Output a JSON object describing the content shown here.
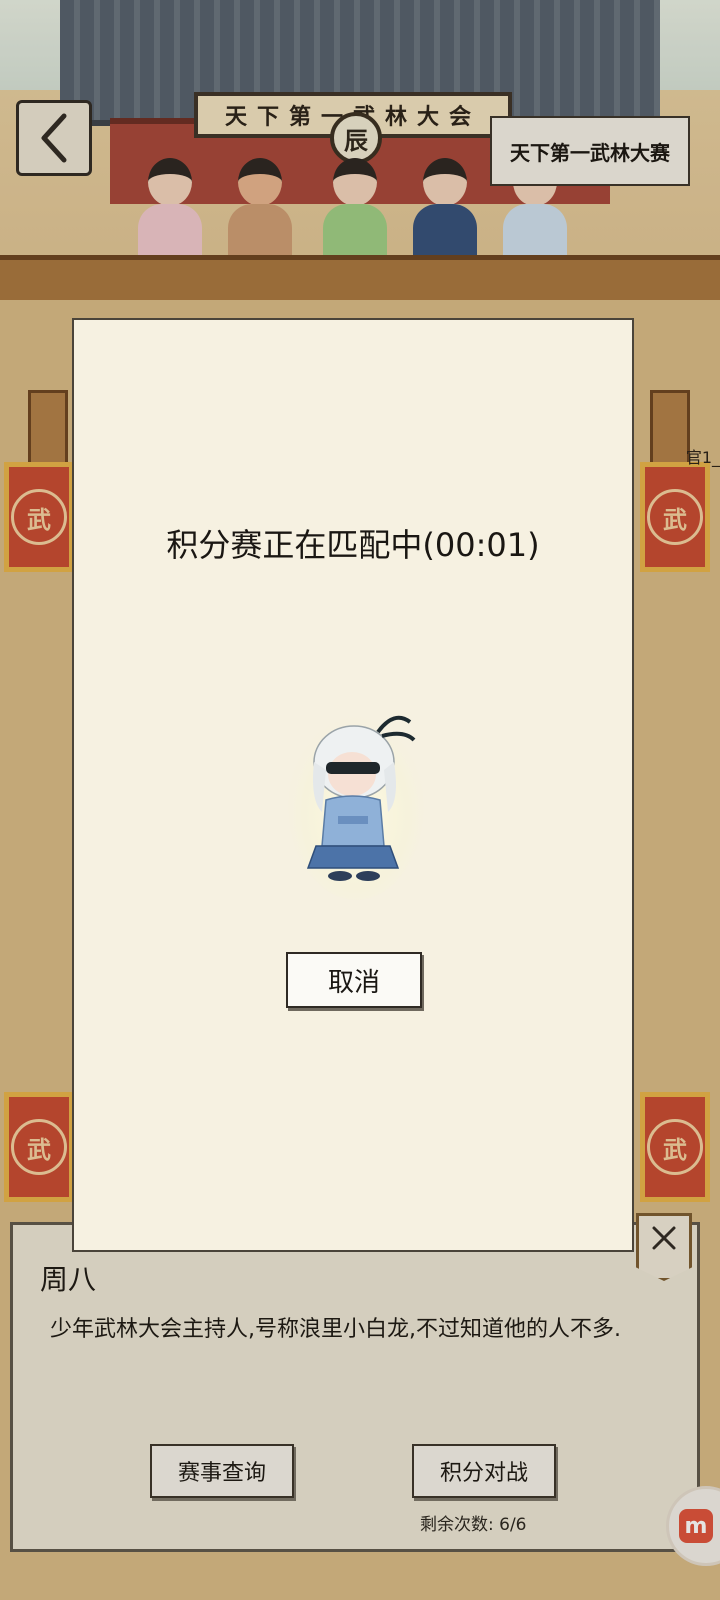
{
  "scene": {
    "hall_sign": "天下第一武林大会",
    "emblem": "辰",
    "banner_glyph": "武",
    "side_label": "官1_"
  },
  "top_bar": {
    "back_icon": "chevron-left-icon",
    "event_title": "天下第一武林大赛"
  },
  "modal": {
    "status_text": "积分赛正在匹配中(00:01)",
    "cancel_label": "取消"
  },
  "npc_panel": {
    "name": "周八",
    "description": "少年武林大会主持人,号称浪里小白龙,不过知道他的人不多.",
    "buttons": {
      "query_label": "赛事查询",
      "battle_label": "积分对战"
    },
    "remaining": "剩余次数:  6/6",
    "close_icon": "close-icon"
  },
  "corner_logo": "m",
  "colors": {
    "modal_bg": "#f6f1e1",
    "panel_bg": "#ece6d6",
    "banner_red": "#c84a32",
    "roof_gray": "#55606e"
  }
}
